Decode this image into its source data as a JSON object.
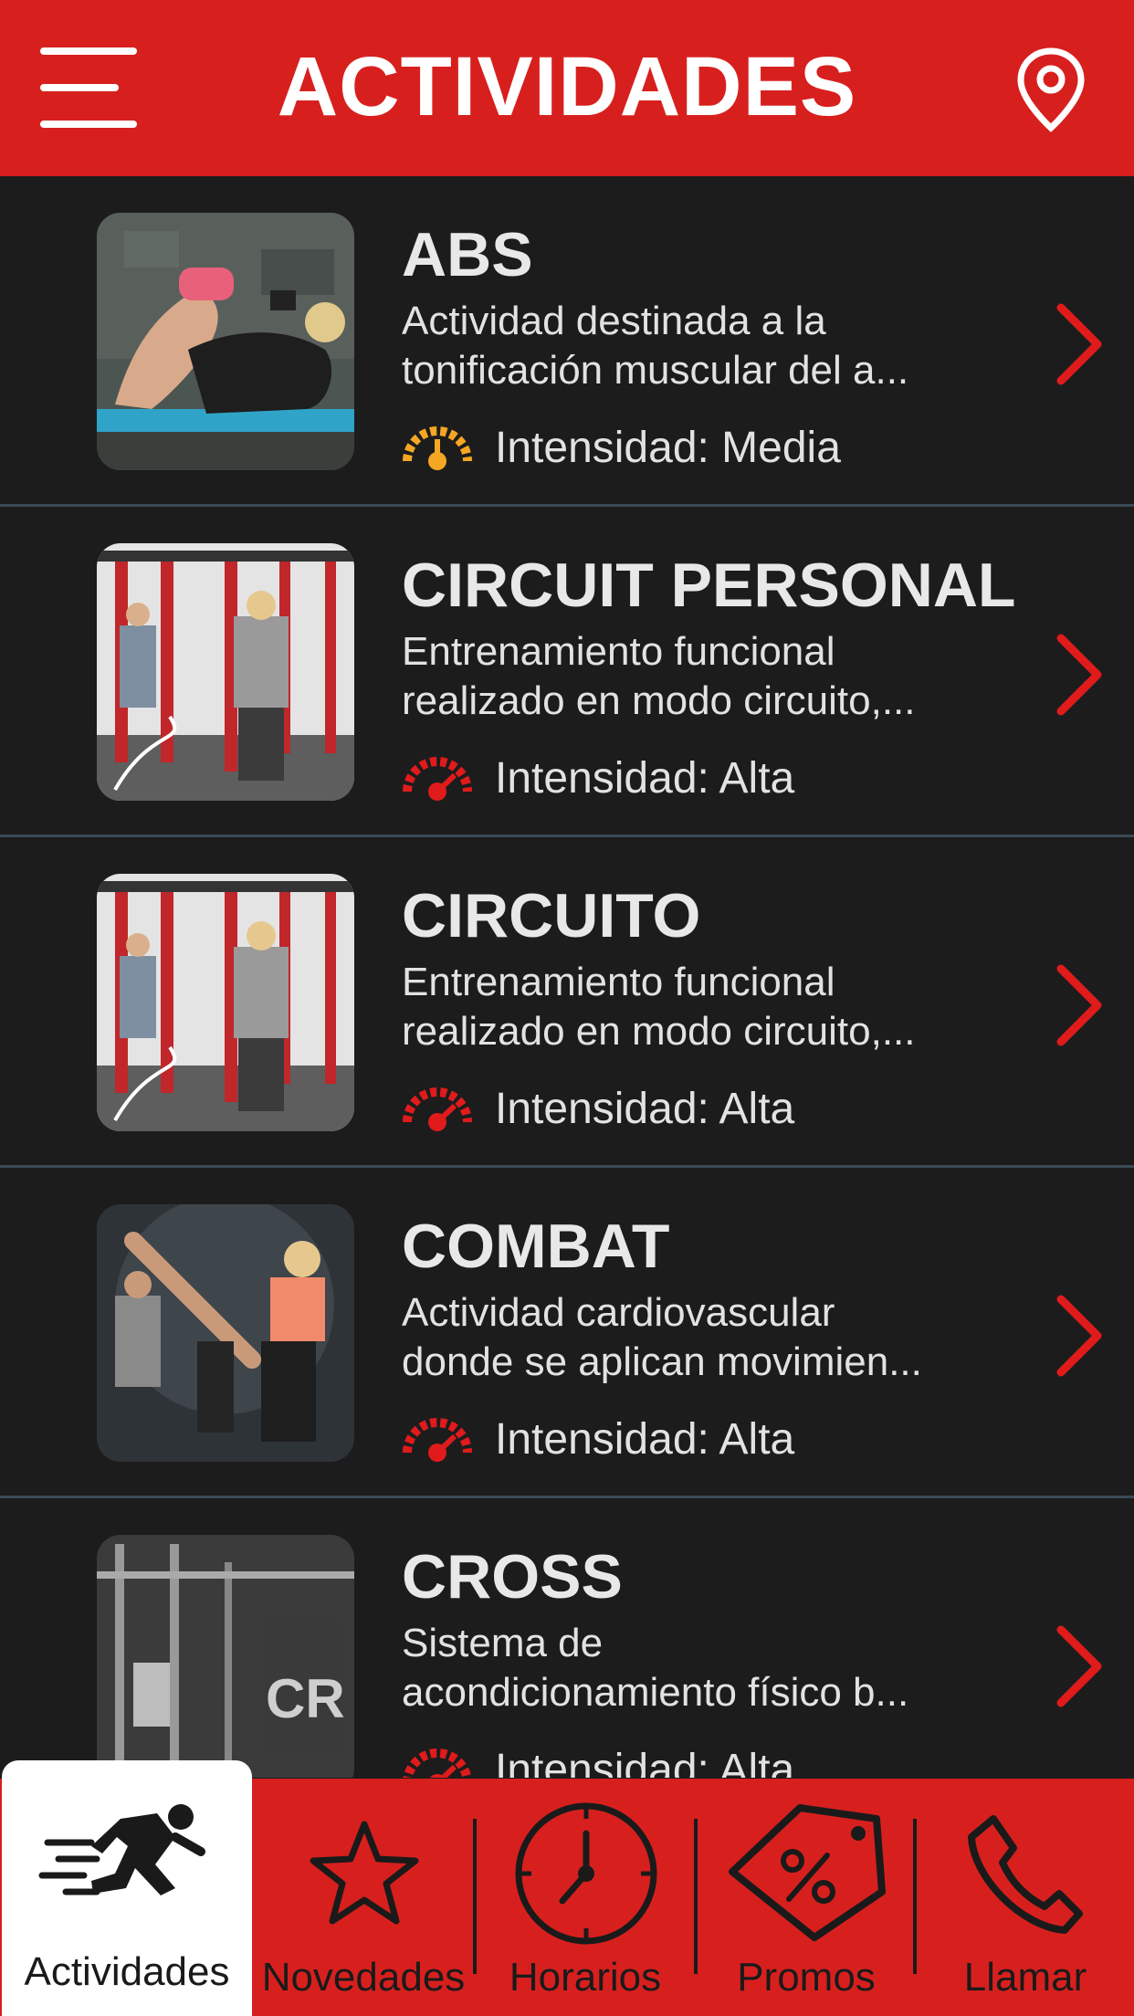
{
  "header": {
    "title": "ACTIVIDADES",
    "menu_icon": "hamburger-menu-icon",
    "location_icon": "map-pin-icon",
    "background": "#d7201e"
  },
  "activities": [
    {
      "title": "ABS",
      "desc_line1": "Actividad destinada a la",
      "desc_line2": "tonificación muscular del a...",
      "intensity": "Intensidad: Media",
      "intensity_level": "media",
      "gauge_color": "#f5a623",
      "image": "abs-photo"
    },
    {
      "title": "CIRCUIT PERSONAL",
      "desc_line1": "Entrenamiento funcional",
      "desc_line2": "realizado en modo circuito,...",
      "intensity": "Intensidad: Alta",
      "intensity_level": "alta",
      "gauge_color": "#e01b1b",
      "image": "circuit-photo"
    },
    {
      "title": "CIRCUITO",
      "desc_line1": "Entrenamiento funcional",
      "desc_line2": "realizado en modo circuito,...",
      "intensity": "Intensidad: Alta",
      "intensity_level": "alta",
      "gauge_color": "#e01b1b",
      "image": "circuit-photo"
    },
    {
      "title": "COMBAT",
      "desc_line1": "Actividad cardiovascular",
      "desc_line2": "donde se aplican movimien...",
      "intensity": "Intensidad: Alta",
      "intensity_level": "alta",
      "gauge_color": "#e01b1b",
      "image": "combat-photo"
    },
    {
      "title": "CROSS",
      "desc_line1": "Sistema de",
      "desc_line2": "acondicionamiento físico b...",
      "intensity": "Intensidad: Alta",
      "intensity_level": "alta",
      "gauge_color": "#e01b1b",
      "image": "cross-photo"
    }
  ],
  "tabs": [
    {
      "label": "Actividades",
      "icon": "running-person-icon",
      "active": true
    },
    {
      "label": "Novedades",
      "icon": "star-icon",
      "active": false
    },
    {
      "label": "Horarios",
      "icon": "clock-icon",
      "active": false
    },
    {
      "label": "Promos",
      "icon": "percent-tag-icon",
      "active": false
    },
    {
      "label": "Llamar",
      "icon": "phone-icon",
      "active": false
    }
  ]
}
